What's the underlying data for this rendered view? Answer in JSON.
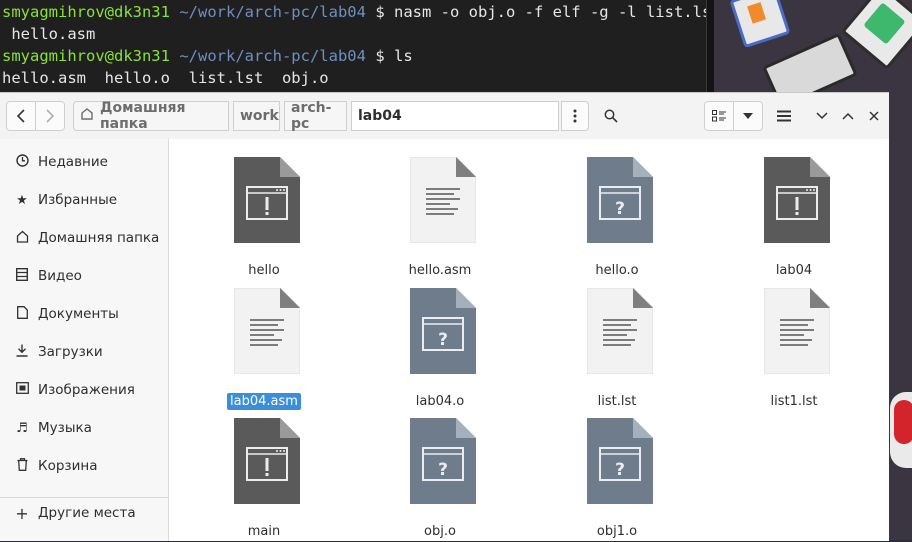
{
  "terminal": {
    "lines": [
      {
        "user": "smyagmihrov@dk3n31",
        "path": "~/work/arch-pc/lab04",
        "prompt": "$",
        "cmd": "nasm -o obj.o -f elf -g -l list.lst"
      },
      {
        "text": " hello.asm"
      },
      {
        "user": "smyagmihrov@dk3n31",
        "path": "~/work/arch-pc/lab04",
        "prompt": "$",
        "cmd": "ls"
      },
      {
        "text": "hello.asm  hello.o  list.lst  obj.o"
      }
    ]
  },
  "toolbar": {
    "back_icon": "chevron-left",
    "forward_icon": "chevron-right",
    "breadcrumbs": [
      "Домашняя папка",
      "work",
      "arch-pc",
      "lab04"
    ],
    "menu_icon": "vertical-dots",
    "search_icon": "magnifier",
    "view_icon": "list-view",
    "sort_icon": "caret-down",
    "hamburger_icon": "hamburger",
    "window_controls": [
      "minimize",
      "maximize",
      "close"
    ]
  },
  "sidebar": {
    "items": [
      {
        "icon": "clock",
        "label": "Недавние"
      },
      {
        "icon": "star",
        "label": "Избранные"
      },
      {
        "icon": "home",
        "label": "Домашняя папка"
      },
      {
        "icon": "film",
        "label": "Видео"
      },
      {
        "icon": "document",
        "label": "Документы"
      },
      {
        "icon": "download",
        "label": "Загрузки"
      },
      {
        "icon": "image",
        "label": "Изображения"
      },
      {
        "icon": "music-note",
        "label": "Музыка"
      },
      {
        "icon": "trash",
        "label": "Корзина"
      }
    ],
    "other_places": {
      "icon": "plus",
      "label": "Другие места"
    }
  },
  "files": [
    {
      "name": "hello",
      "kind": "executable"
    },
    {
      "name": "hello.asm",
      "kind": "text"
    },
    {
      "name": "hello.o",
      "kind": "object"
    },
    {
      "name": "lab04",
      "kind": "executable"
    },
    {
      "name": "lab04.asm",
      "kind": "text",
      "selected": true
    },
    {
      "name": "lab04.o",
      "kind": "object"
    },
    {
      "name": "list.lst",
      "kind": "text"
    },
    {
      "name": "list1.lst",
      "kind": "text"
    },
    {
      "name": "main",
      "kind": "executable"
    },
    {
      "name": "obj.o",
      "kind": "object"
    },
    {
      "name": "obj1.o",
      "kind": "object"
    }
  ]
}
